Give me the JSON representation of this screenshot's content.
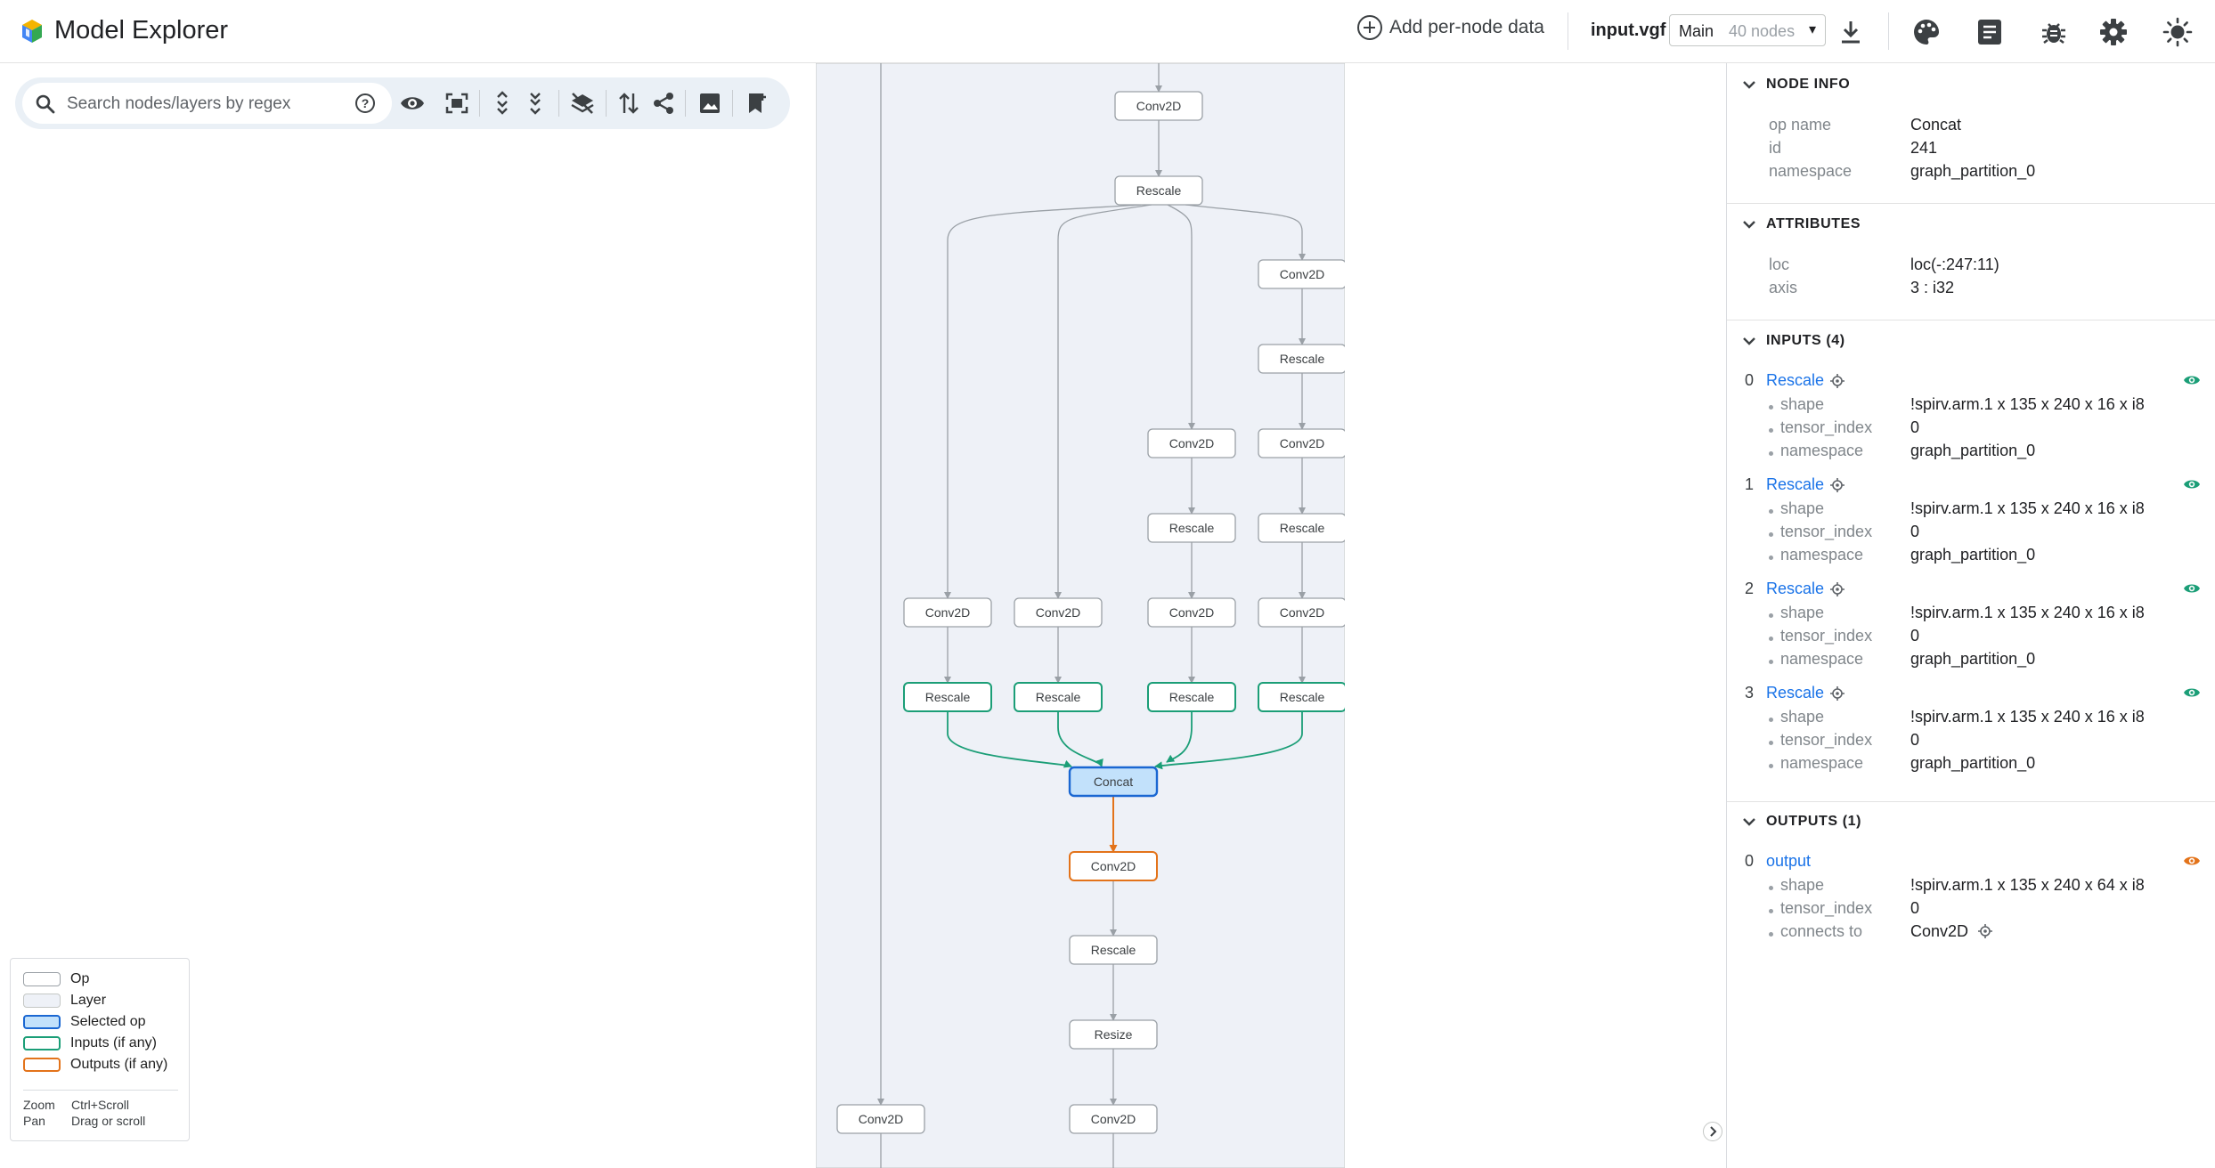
{
  "app": {
    "title": "Model Explorer"
  },
  "toolbar": {
    "add_node_data_label": "Add per-node data",
    "file_name": "input.vgf",
    "graph_select": {
      "selected": "Main",
      "node_count": "40 nodes"
    },
    "icons": [
      "download-icon",
      "palette-icon",
      "document-icon",
      "bug-icon",
      "settings-icon",
      "theme-toggle-icon"
    ]
  },
  "search": {
    "placeholder": "Search nodes/layers by regex"
  },
  "graph_tools": [
    "visibility-icon",
    "fit-to-screen-icon",
    "expand-all-icon",
    "collapse-all-icon",
    "hide-layers-icon",
    "flatten-icon",
    "share-icon",
    "screenshot-icon",
    "bookmark-add-icon"
  ],
  "graph": {
    "nodes": [
      {
        "id": "n1",
        "label": "Conv2D",
        "role": "op"
      },
      {
        "id": "n2",
        "label": "Rescale",
        "role": "op"
      },
      {
        "id": "n3",
        "label": "Conv2D",
        "role": "op"
      },
      {
        "id": "n4",
        "label": "Rescale",
        "role": "op"
      },
      {
        "id": "n5",
        "label": "Conv2D",
        "role": "op"
      },
      {
        "id": "n6",
        "label": "Conv2D",
        "role": "op"
      },
      {
        "id": "n7",
        "label": "Rescale",
        "role": "op"
      },
      {
        "id": "n8",
        "label": "Rescale",
        "role": "op"
      },
      {
        "id": "n9",
        "label": "Conv2D",
        "role": "op"
      },
      {
        "id": "n10",
        "label": "Conv2D",
        "role": "op"
      },
      {
        "id": "n11",
        "label": "Conv2D",
        "role": "op"
      },
      {
        "id": "n12",
        "label": "Conv2D",
        "role": "op"
      },
      {
        "id": "n13",
        "label": "Rescale",
        "role": "input"
      },
      {
        "id": "n14",
        "label": "Rescale",
        "role": "input"
      },
      {
        "id": "n15",
        "label": "Rescale",
        "role": "input"
      },
      {
        "id": "n16",
        "label": "Rescale",
        "role": "input"
      },
      {
        "id": "n17",
        "label": "Concat",
        "role": "selected"
      },
      {
        "id": "n18",
        "label": "Conv2D",
        "role": "output"
      },
      {
        "id": "n19",
        "label": "Rescale",
        "role": "op"
      },
      {
        "id": "n20",
        "label": "Resize",
        "role": "op"
      },
      {
        "id": "n21",
        "label": "Conv2D",
        "role": "op"
      },
      {
        "id": "n22",
        "label": "Conv2D",
        "role": "op"
      }
    ]
  },
  "legend": {
    "items": [
      {
        "label": "Op",
        "border": "#9aa0a6",
        "fill": "#ffffff"
      },
      {
        "label": "Layer",
        "border": "#c4c7c5",
        "fill": "#eef1f7"
      },
      {
        "label": "Selected op",
        "border": "#1a67d2",
        "fill": "#c2e1fb"
      },
      {
        "label": "Inputs (if any)",
        "border": "#1b9e77",
        "fill": "#ffffff"
      },
      {
        "label": "Outputs (if any)",
        "border": "#e3731a",
        "fill": "#ffffff"
      }
    ],
    "zoom_key": "Zoom",
    "zoom_value": "Ctrl+Scroll",
    "pan_key": "Pan",
    "pan_value": "Drag or scroll"
  },
  "node_info": {
    "title": "NODE INFO",
    "rows": [
      {
        "k": "op name",
        "v": "Concat"
      },
      {
        "k": "id",
        "v": "241"
      },
      {
        "k": "namespace",
        "v": "graph_partition_0"
      }
    ]
  },
  "attributes": {
    "title": "ATTRIBUTES",
    "rows": [
      {
        "k": "loc",
        "v": "loc(-:247:11)"
      },
      {
        "k": "axis",
        "v": "3 : i32"
      }
    ]
  },
  "inputs": {
    "title": "INPUTS (4)",
    "items": [
      {
        "idx": "0",
        "name": "Rescale",
        "shape": "!spirv.arm.1 x 135 x 240 x 16 x i8",
        "tensor_index": "0",
        "namespace": "graph_partition_0"
      },
      {
        "idx": "1",
        "name": "Rescale",
        "shape": "!spirv.arm.1 x 135 x 240 x 16 x i8",
        "tensor_index": "0",
        "namespace": "graph_partition_0"
      },
      {
        "idx": "2",
        "name": "Rescale",
        "shape": "!spirv.arm.1 x 135 x 240 x 16 x i8",
        "tensor_index": "0",
        "namespace": "graph_partition_0"
      },
      {
        "idx": "3",
        "name": "Rescale",
        "shape": "!spirv.arm.1 x 135 x 240 x 16 x i8",
        "tensor_index": "0",
        "namespace": "graph_partition_0"
      }
    ],
    "keys": {
      "shape": "shape",
      "tensor_index": "tensor_index",
      "namespace": "namespace"
    }
  },
  "outputs": {
    "title": "OUTPUTS (1)",
    "item": {
      "idx": "0",
      "name": "output",
      "shape": "!spirv.arm.1 x 135 x 240 x 64 x i8",
      "tensor_index": "0",
      "connects_to": "Conv2D"
    },
    "keys": {
      "shape": "shape",
      "tensor_index": "tensor_index",
      "connects_to": "connects to"
    }
  },
  "colors": {
    "accent": "#1a73e8",
    "input": "#1b9e77",
    "output": "#e3731a",
    "selected_fill": "#c2e1fb",
    "layer_bg": "#eef1f7"
  }
}
